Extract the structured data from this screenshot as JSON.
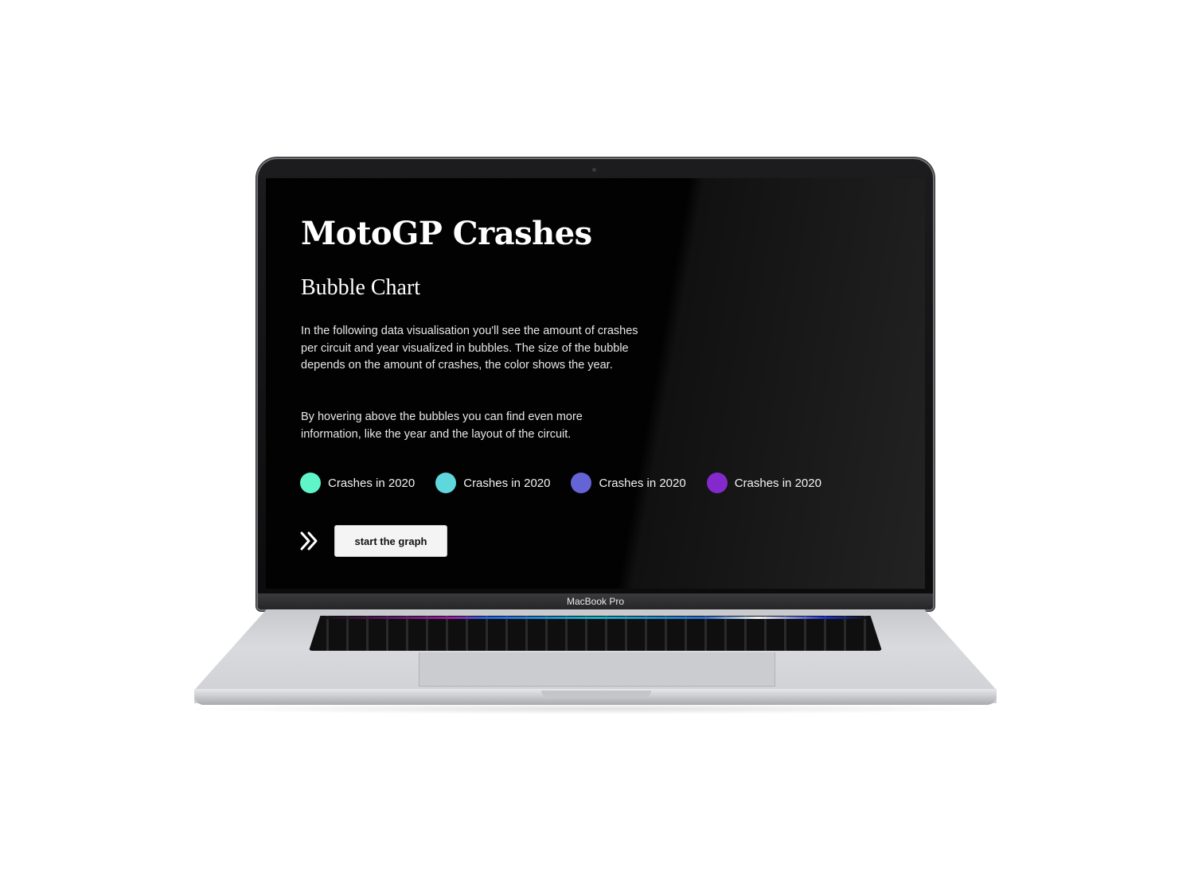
{
  "device": {
    "model_label": "MacBook Pro"
  },
  "page": {
    "title": "MotoGP Crashes",
    "subtitle": "Bubble Chart",
    "paragraphs": [
      "In the following data visualisation you'll see the amount of crashes per circuit and year visualized in bubbles. The size of the bubble depends on the amount of crashes, the color shows the year.",
      "By hovering above the bubbles you can find even more information, like the year and the layout of the circuit."
    ],
    "legend": [
      {
        "label": "Crashes in 2020",
        "color": "#5ef5c8"
      },
      {
        "label": "Crashes in 2020",
        "color": "#5ed8dc"
      },
      {
        "label": "Crashes in 2020",
        "color": "#6464d6"
      },
      {
        "label": "Crashes in 2020",
        "color": "#7a18c8"
      }
    ],
    "cta": {
      "icon": "double-chevron-right-icon",
      "button_label": "start the graph"
    }
  },
  "colors": {
    "screen_background": "#020202",
    "text": "#ffffff",
    "button_background": "#f4f4f4"
  }
}
